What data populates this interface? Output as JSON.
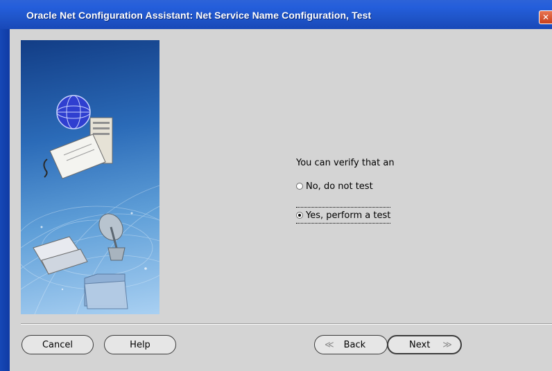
{
  "window": {
    "title": "Oracle Net Configuration Assistant: Net Service Name Configuration, Test",
    "close_glyph": "✕"
  },
  "content": {
    "prompt": "You can verify that an",
    "options": [
      {
        "label": "No, do not test",
        "checked": false
      },
      {
        "label": "Yes, perform a test",
        "checked": true
      }
    ]
  },
  "buttons": {
    "cancel": "Cancel",
    "help": "Help",
    "back": "Back",
    "next": "Next",
    "back_chevron": "≪",
    "next_chevron": "≫"
  },
  "colors": {
    "titlebar": "#245edb",
    "client_bg": "#d4d4d4",
    "close_button": "#d9552f"
  },
  "icons": {
    "side_image": "oracle-network-illustration",
    "globe": "globe-icon",
    "server": "server-icon",
    "satellite": "satellite-dish-icon",
    "folder": "folder-icon"
  }
}
